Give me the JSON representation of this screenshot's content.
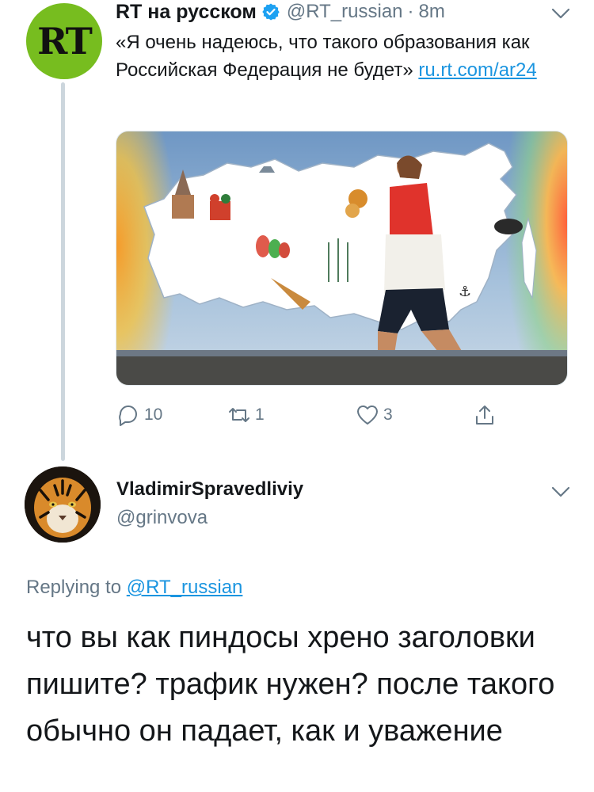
{
  "tweet1": {
    "avatar_text": "RT",
    "display_name": "RT на русском",
    "verified_icon": "verified-badge-icon",
    "handle": "@RT_russian",
    "separator": "·",
    "time": "8m",
    "text": "«Я очень надеюсь, что такого образования как Российская Федерация не будет»",
    "link": "ru.rt.com/ar24",
    "actions": {
      "reply_count": "10",
      "retweet_count": "1",
      "like_count": "3"
    }
  },
  "tweet2": {
    "display_name": "VladimirSpravedliviy",
    "handle": "@grinvova",
    "replying_prefix": "Replying to",
    "replying_to": "@RT_russian",
    "text": "что вы как пиндосы хрено заголовки пишите? трафик нужен? после такого обычно он падает, как и уважение"
  },
  "colors": {
    "accent": "#1b95e0",
    "muted": "#657786",
    "rt_green": "#77bd1f",
    "thread_line": "#ccd6dd"
  }
}
